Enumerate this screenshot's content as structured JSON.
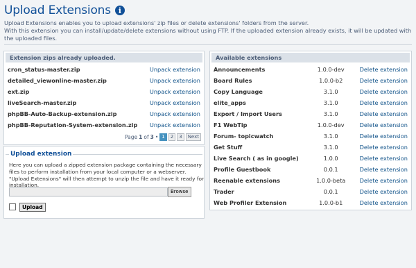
{
  "header": {
    "title": "Upload Extensions",
    "description": [
      "Upload Extensions enables you to upload extensions' zip files or delete extensions' folders from the server.",
      "With this extension you can install/update/delete extensions without using FTP. If the uploaded extension already exists, it will be updated with the uploaded files."
    ]
  },
  "zips": {
    "heading": "Extension zips already uploaded.",
    "action_label": "Unpack extension",
    "items": [
      "cron_status-master.zip",
      "detailed_viewonline-master.zip",
      "ext.zip",
      "liveSearch-master.zip",
      "phpBB-Auto-Backup-extension.zip",
      "phpBB-Reputation-System-extension.zip"
    ],
    "pager": {
      "prefix": "Page",
      "current": "1",
      "of": "of",
      "total": "3",
      "bullet": "•",
      "pages": [
        "1",
        "2",
        "3"
      ],
      "next": "Next"
    }
  },
  "upload": {
    "heading": "Upload extension",
    "description": "Here you can upload a zipped extension package containing the necessary files to perform installation from your local computer or a webserver. \"Upload Extensions\" will then attempt to unzip the file and have it ready for installation.",
    "browse_label": "Browse",
    "upload_label": "Upload"
  },
  "available": {
    "heading": "Available extensions",
    "action_label": "Delete extension",
    "items": [
      {
        "name": "Announcements",
        "version": "1.0.0-dev"
      },
      {
        "name": "Board Rules",
        "version": "1.0.0-b2"
      },
      {
        "name": "Copy Language",
        "version": "3.1.0"
      },
      {
        "name": "elite_apps",
        "version": "3.1.0"
      },
      {
        "name": "Export / Import Users",
        "version": "3.1.0"
      },
      {
        "name": "F1 WebTip",
        "version": "1.0.0-dev"
      },
      {
        "name": "Forum- topicwatch",
        "version": "3.1.0"
      },
      {
        "name": "Get Stuff",
        "version": "3.1.0"
      },
      {
        "name": "Live Search ( as in google)",
        "version": "1.0.0"
      },
      {
        "name": "Profile Guestbook",
        "version": "0.0.1"
      },
      {
        "name": "Reenable extensions",
        "version": "1.0.0-beta"
      },
      {
        "name": "Trader",
        "version": "0.0.1"
      },
      {
        "name": "Web Profiler Extension",
        "version": "1.0.0-b1"
      }
    ]
  },
  "colors": {
    "accent": "#115098",
    "link": "#105289",
    "panel_head_bg": "#dbe1e8",
    "page_bg": "#f2f4f6"
  }
}
